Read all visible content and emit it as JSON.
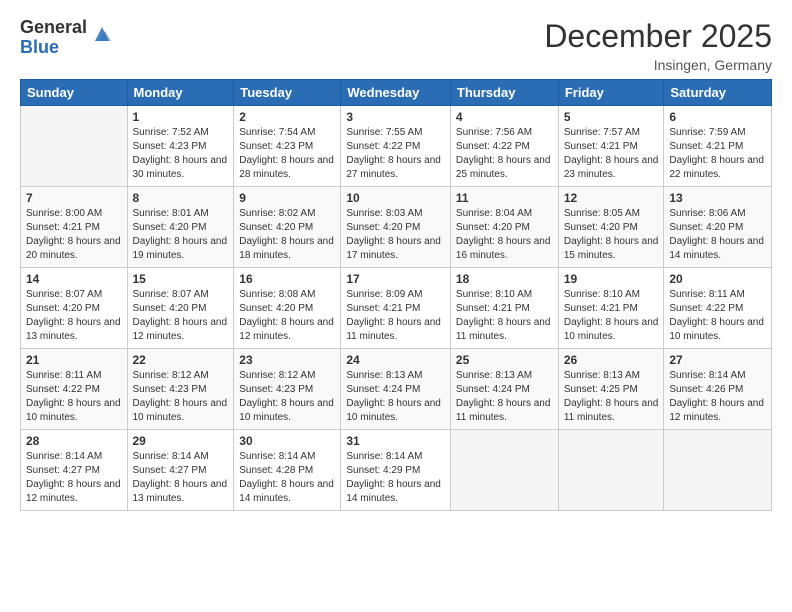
{
  "header": {
    "logo_general": "General",
    "logo_blue": "Blue",
    "month_year": "December 2025",
    "location": "Insingen, Germany"
  },
  "weekdays": [
    "Sunday",
    "Monday",
    "Tuesday",
    "Wednesday",
    "Thursday",
    "Friday",
    "Saturday"
  ],
  "weeks": [
    [
      {
        "day": "",
        "sunrise": "",
        "sunset": "",
        "daylight": ""
      },
      {
        "day": "1",
        "sunrise": "Sunrise: 7:52 AM",
        "sunset": "Sunset: 4:23 PM",
        "daylight": "Daylight: 8 hours and 30 minutes."
      },
      {
        "day": "2",
        "sunrise": "Sunrise: 7:54 AM",
        "sunset": "Sunset: 4:23 PM",
        "daylight": "Daylight: 8 hours and 28 minutes."
      },
      {
        "day": "3",
        "sunrise": "Sunrise: 7:55 AM",
        "sunset": "Sunset: 4:22 PM",
        "daylight": "Daylight: 8 hours and 27 minutes."
      },
      {
        "day": "4",
        "sunrise": "Sunrise: 7:56 AM",
        "sunset": "Sunset: 4:22 PM",
        "daylight": "Daylight: 8 hours and 25 minutes."
      },
      {
        "day": "5",
        "sunrise": "Sunrise: 7:57 AM",
        "sunset": "Sunset: 4:21 PM",
        "daylight": "Daylight: 8 hours and 23 minutes."
      },
      {
        "day": "6",
        "sunrise": "Sunrise: 7:59 AM",
        "sunset": "Sunset: 4:21 PM",
        "daylight": "Daylight: 8 hours and 22 minutes."
      }
    ],
    [
      {
        "day": "7",
        "sunrise": "Sunrise: 8:00 AM",
        "sunset": "Sunset: 4:21 PM",
        "daylight": "Daylight: 8 hours and 20 minutes."
      },
      {
        "day": "8",
        "sunrise": "Sunrise: 8:01 AM",
        "sunset": "Sunset: 4:20 PM",
        "daylight": "Daylight: 8 hours and 19 minutes."
      },
      {
        "day": "9",
        "sunrise": "Sunrise: 8:02 AM",
        "sunset": "Sunset: 4:20 PM",
        "daylight": "Daylight: 8 hours and 18 minutes."
      },
      {
        "day": "10",
        "sunrise": "Sunrise: 8:03 AM",
        "sunset": "Sunset: 4:20 PM",
        "daylight": "Daylight: 8 hours and 17 minutes."
      },
      {
        "day": "11",
        "sunrise": "Sunrise: 8:04 AM",
        "sunset": "Sunset: 4:20 PM",
        "daylight": "Daylight: 8 hours and 16 minutes."
      },
      {
        "day": "12",
        "sunrise": "Sunrise: 8:05 AM",
        "sunset": "Sunset: 4:20 PM",
        "daylight": "Daylight: 8 hours and 15 minutes."
      },
      {
        "day": "13",
        "sunrise": "Sunrise: 8:06 AM",
        "sunset": "Sunset: 4:20 PM",
        "daylight": "Daylight: 8 hours and 14 minutes."
      }
    ],
    [
      {
        "day": "14",
        "sunrise": "Sunrise: 8:07 AM",
        "sunset": "Sunset: 4:20 PM",
        "daylight": "Daylight: 8 hours and 13 minutes."
      },
      {
        "day": "15",
        "sunrise": "Sunrise: 8:07 AM",
        "sunset": "Sunset: 4:20 PM",
        "daylight": "Daylight: 8 hours and 12 minutes."
      },
      {
        "day": "16",
        "sunrise": "Sunrise: 8:08 AM",
        "sunset": "Sunset: 4:20 PM",
        "daylight": "Daylight: 8 hours and 12 minutes."
      },
      {
        "day": "17",
        "sunrise": "Sunrise: 8:09 AM",
        "sunset": "Sunset: 4:21 PM",
        "daylight": "Daylight: 8 hours and 11 minutes."
      },
      {
        "day": "18",
        "sunrise": "Sunrise: 8:10 AM",
        "sunset": "Sunset: 4:21 PM",
        "daylight": "Daylight: 8 hours and 11 minutes."
      },
      {
        "day": "19",
        "sunrise": "Sunrise: 8:10 AM",
        "sunset": "Sunset: 4:21 PM",
        "daylight": "Daylight: 8 hours and 10 minutes."
      },
      {
        "day": "20",
        "sunrise": "Sunrise: 8:11 AM",
        "sunset": "Sunset: 4:22 PM",
        "daylight": "Daylight: 8 hours and 10 minutes."
      }
    ],
    [
      {
        "day": "21",
        "sunrise": "Sunrise: 8:11 AM",
        "sunset": "Sunset: 4:22 PM",
        "daylight": "Daylight: 8 hours and 10 minutes."
      },
      {
        "day": "22",
        "sunrise": "Sunrise: 8:12 AM",
        "sunset": "Sunset: 4:23 PM",
        "daylight": "Daylight: 8 hours and 10 minutes."
      },
      {
        "day": "23",
        "sunrise": "Sunrise: 8:12 AM",
        "sunset": "Sunset: 4:23 PM",
        "daylight": "Daylight: 8 hours and 10 minutes."
      },
      {
        "day": "24",
        "sunrise": "Sunrise: 8:13 AM",
        "sunset": "Sunset: 4:24 PM",
        "daylight": "Daylight: 8 hours and 10 minutes."
      },
      {
        "day": "25",
        "sunrise": "Sunrise: 8:13 AM",
        "sunset": "Sunset: 4:24 PM",
        "daylight": "Daylight: 8 hours and 11 minutes."
      },
      {
        "day": "26",
        "sunrise": "Sunrise: 8:13 AM",
        "sunset": "Sunset: 4:25 PM",
        "daylight": "Daylight: 8 hours and 11 minutes."
      },
      {
        "day": "27",
        "sunrise": "Sunrise: 8:14 AM",
        "sunset": "Sunset: 4:26 PM",
        "daylight": "Daylight: 8 hours and 12 minutes."
      }
    ],
    [
      {
        "day": "28",
        "sunrise": "Sunrise: 8:14 AM",
        "sunset": "Sunset: 4:27 PM",
        "daylight": "Daylight: 8 hours and 12 minutes."
      },
      {
        "day": "29",
        "sunrise": "Sunrise: 8:14 AM",
        "sunset": "Sunset: 4:27 PM",
        "daylight": "Daylight: 8 hours and 13 minutes."
      },
      {
        "day": "30",
        "sunrise": "Sunrise: 8:14 AM",
        "sunset": "Sunset: 4:28 PM",
        "daylight": "Daylight: 8 hours and 14 minutes."
      },
      {
        "day": "31",
        "sunrise": "Sunrise: 8:14 AM",
        "sunset": "Sunset: 4:29 PM",
        "daylight": "Daylight: 8 hours and 14 minutes."
      },
      {
        "day": "",
        "sunrise": "",
        "sunset": "",
        "daylight": ""
      },
      {
        "day": "",
        "sunrise": "",
        "sunset": "",
        "daylight": ""
      },
      {
        "day": "",
        "sunrise": "",
        "sunset": "",
        "daylight": ""
      }
    ]
  ]
}
